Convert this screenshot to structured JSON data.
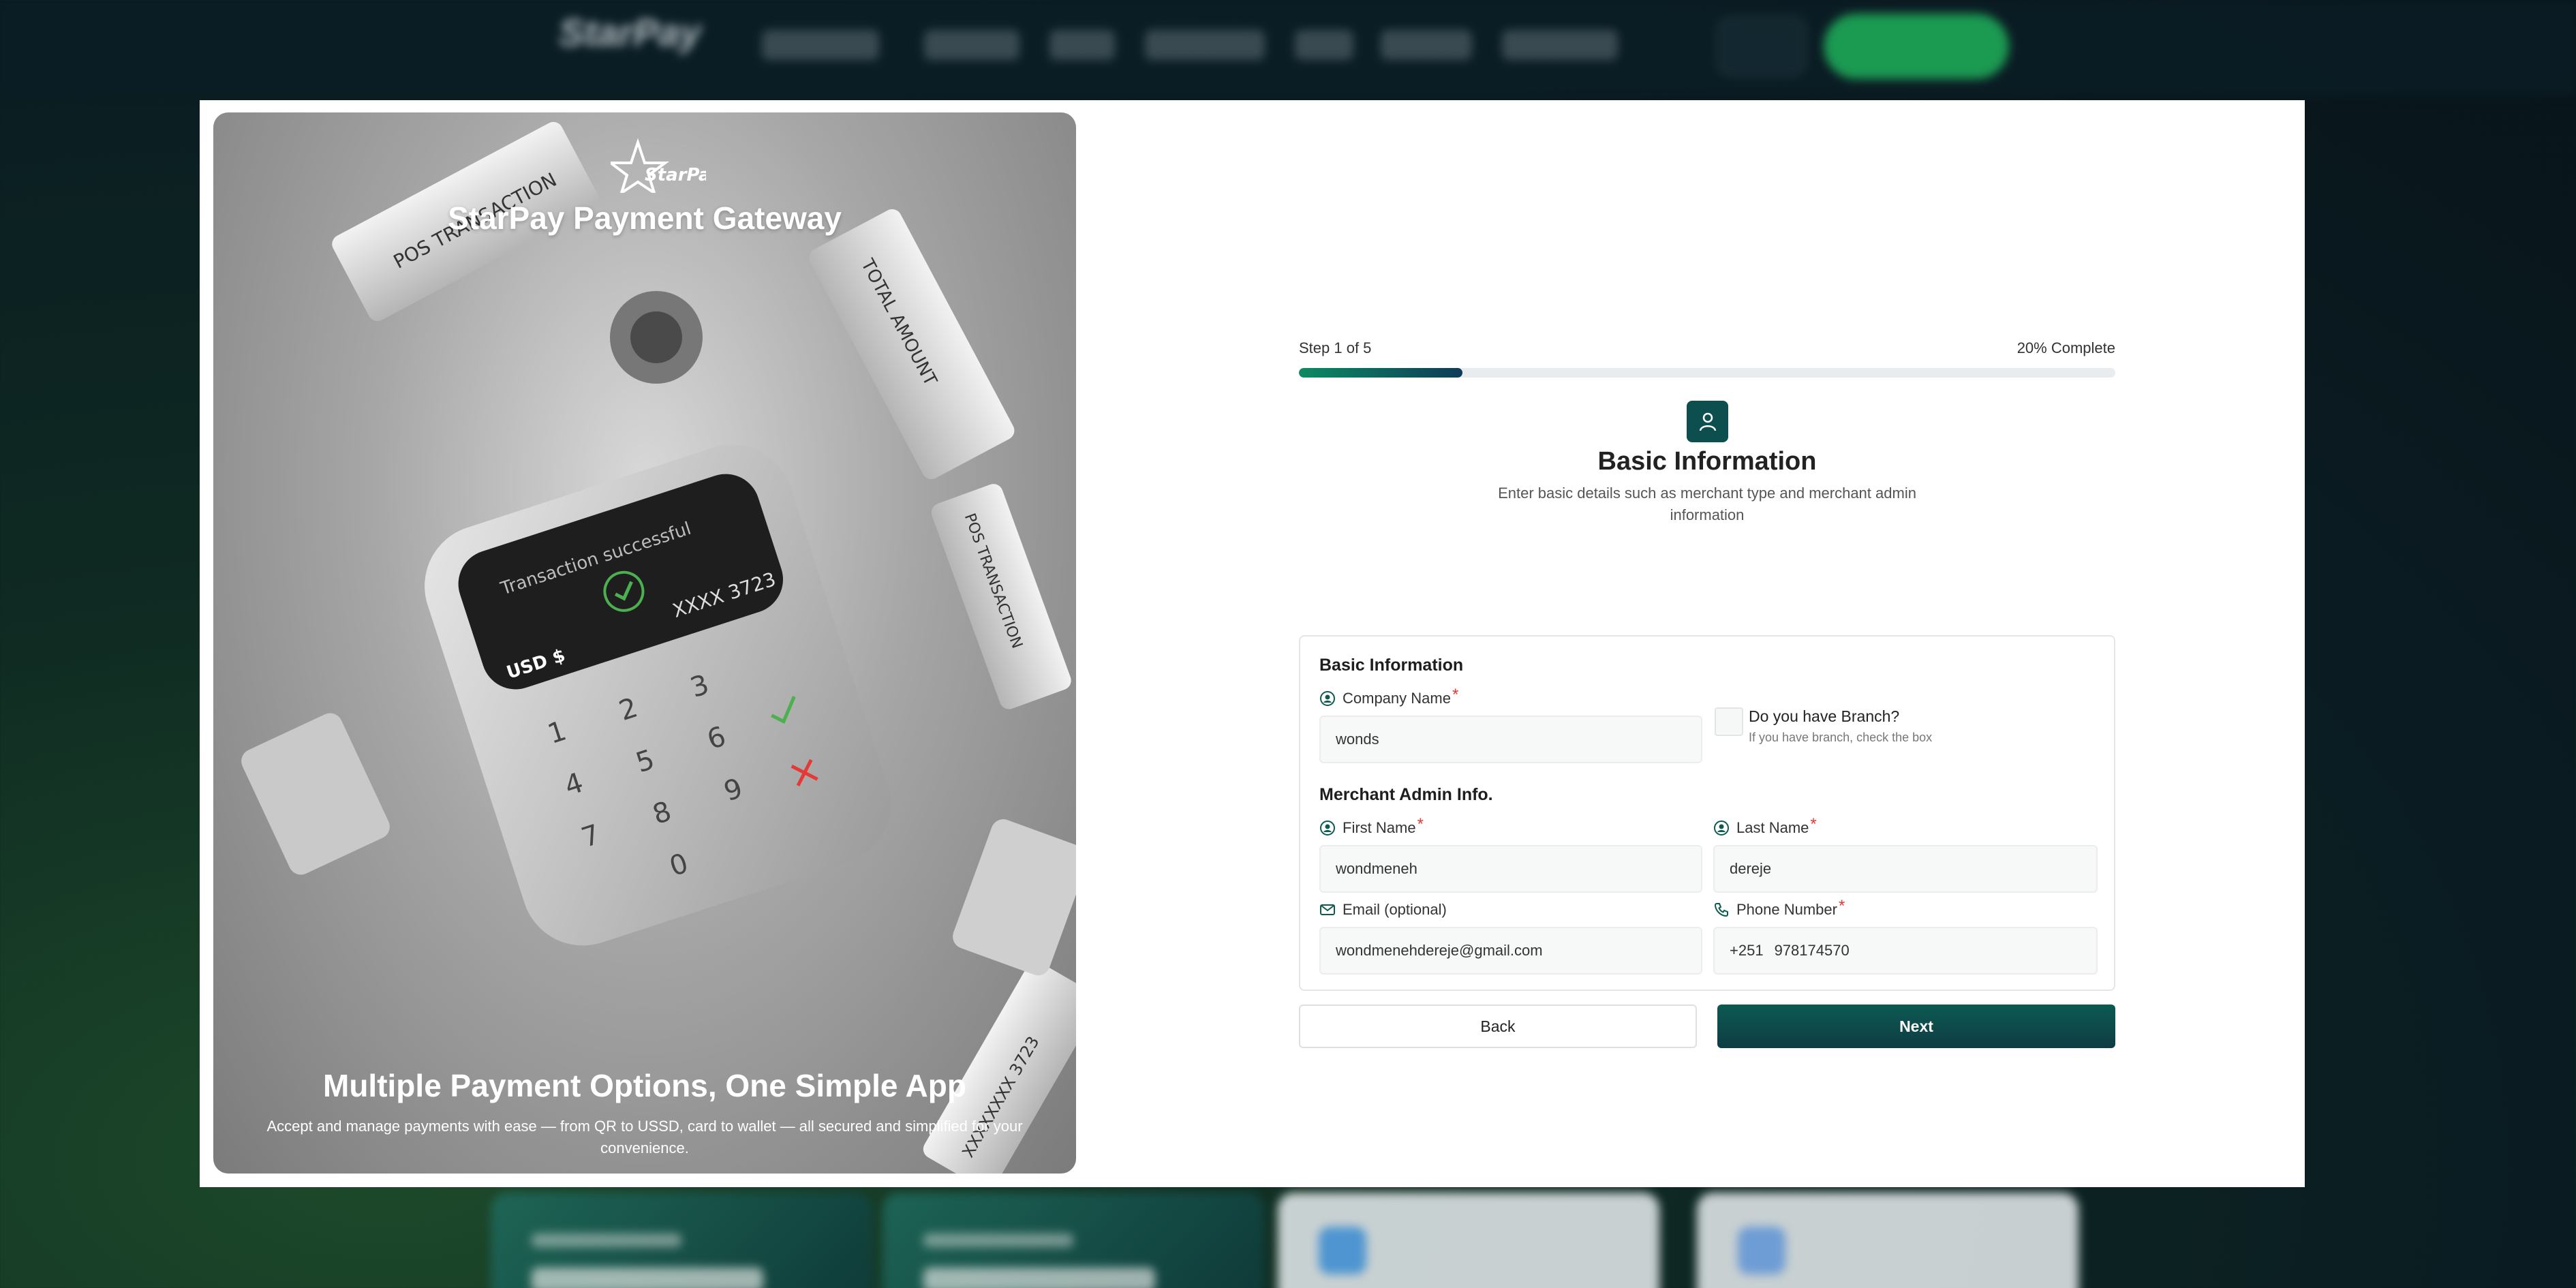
{
  "brand": {
    "logo_text": "StarPay",
    "title": "StarPay Payment Gateway"
  },
  "hero": {
    "device_screen_text": "Transaction successful",
    "device_card_number": "XXXX 3723",
    "device_currency": "USD $",
    "receipt_texts": [
      "POS TRANSACTION",
      "TOTAL AMOUNT",
      "POS TRANSACTION",
      "XXXXXXXX 3723"
    ]
  },
  "promo": {
    "title": "Multiple Payment Options, One Simple App",
    "text": "Accept and manage payments with ease — from QR to USSD, card to wallet — all secured and simplified for your convenience."
  },
  "progress": {
    "step_label": "Step 1 of 5",
    "complete_label": "20% Complete",
    "fraction": 0.2
  },
  "step": {
    "icon": "user-icon",
    "title": "Basic Information",
    "subtitle": "Enter basic details such as merchant type and merchant admin information"
  },
  "form": {
    "section_basic": "Basic Information",
    "company_name": {
      "label": "Company Name",
      "required": "*",
      "value": "wonds"
    },
    "branch": {
      "question": "Do you have Branch?",
      "hint": "If you have branch, check the box",
      "checked": false
    },
    "section_admin": "Merchant Admin Info.",
    "first_name": {
      "label": "First Name",
      "required": "*",
      "value": "wondmeneh"
    },
    "last_name": {
      "label": "Last Name",
      "required": "*",
      "value": "dereje"
    },
    "email": {
      "label": "Email (optional)",
      "value": "wondmenehdereje@gmail.com"
    },
    "phone": {
      "label": "Phone Number",
      "required": "*",
      "prefix": "+251",
      "value": "978174570"
    }
  },
  "actions": {
    "back": "Back",
    "next": "Next"
  },
  "colors": {
    "primary": "#0d4f4f",
    "progress_start": "#0d8a63",
    "progress_end": "#0e3b57",
    "required": "#e53935"
  }
}
